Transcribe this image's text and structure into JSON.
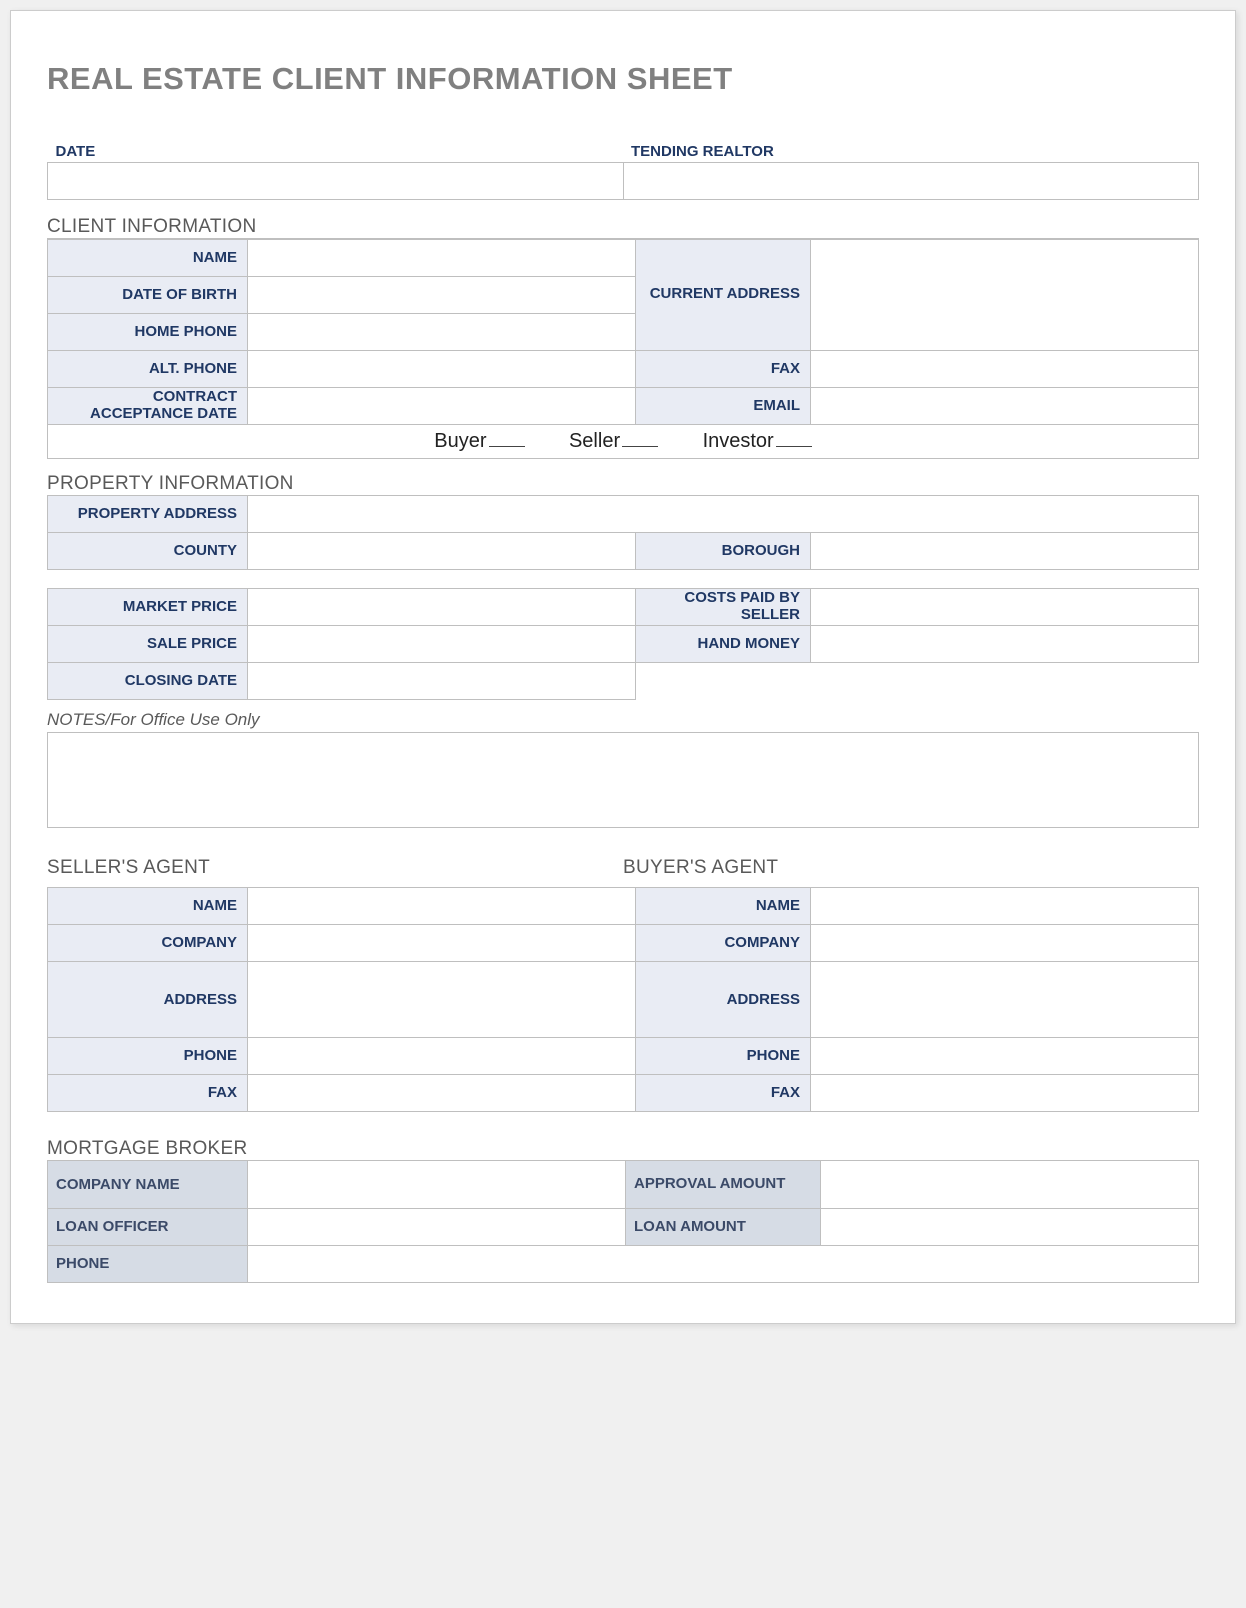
{
  "title": "REAL ESTATE CLIENT INFORMATION SHEET",
  "top": {
    "date_label": "DATE",
    "realtor_label": "TENDING REALTOR",
    "date_value": "",
    "realtor_value": ""
  },
  "client": {
    "section_title": "CLIENT INFORMATION",
    "name_label": "NAME",
    "dob_label": "DATE OF BIRTH",
    "home_phone_label": "HOME PHONE",
    "alt_phone_label": "ALT. PHONE",
    "contract_date_label": "CONTRACT ACCEPTANCE DATE",
    "current_address_label": "CURRENT ADDRESS",
    "fax_label": "FAX",
    "email_label": "EMAIL",
    "name_value": "",
    "dob_value": "",
    "home_phone_value": "",
    "alt_phone_value": "",
    "contract_date_value": "",
    "current_address_value": "",
    "fax_value": "",
    "email_value": "",
    "role_buyer": "Buyer",
    "role_seller": "Seller",
    "role_investor": "Investor"
  },
  "property": {
    "section_title": "PROPERTY INFORMATION",
    "address_label": "PROPERTY ADDRESS",
    "county_label": "COUNTY",
    "borough_label": "BOROUGH",
    "market_price_label": "MARKET PRICE",
    "sale_price_label": "SALE PRICE",
    "closing_date_label": "CLOSING DATE",
    "costs_paid_label": "COSTS PAID BY SELLER",
    "hand_money_label": "HAND MONEY",
    "address_value": "",
    "county_value": "",
    "borough_value": "",
    "market_price_value": "",
    "sale_price_value": "",
    "closing_date_value": "",
    "costs_paid_value": "",
    "hand_money_value": ""
  },
  "notes": {
    "header": "NOTES/For Office Use Only",
    "value": ""
  },
  "seller_agent": {
    "section_title": "SELLER'S AGENT",
    "name_label": "NAME",
    "company_label": "COMPANY",
    "address_label": "ADDRESS",
    "phone_label": "PHONE",
    "fax_label": "FAX",
    "name_value": "",
    "company_value": "",
    "address_value": "",
    "phone_value": "",
    "fax_value": ""
  },
  "buyer_agent": {
    "section_title": "BUYER'S AGENT",
    "name_label": "NAME",
    "company_label": "COMPANY",
    "address_label": "ADDRESS",
    "phone_label": "PHONE",
    "fax_label": "FAX",
    "name_value": "",
    "company_value": "",
    "address_value": "",
    "phone_value": "",
    "fax_value": ""
  },
  "broker": {
    "section_title": "MORTGAGE BROKER",
    "company_name_label": "COMPANY NAME",
    "loan_officer_label": "LOAN OFFICER",
    "phone_label": "PHONE",
    "approval_amount_label": "APPROVAL AMOUNT",
    "loan_amount_label": "LOAN AMOUNT",
    "company_name_value": "",
    "loan_officer_value": "",
    "phone_value": "",
    "approval_amount_value": "",
    "loan_amount_value": ""
  }
}
